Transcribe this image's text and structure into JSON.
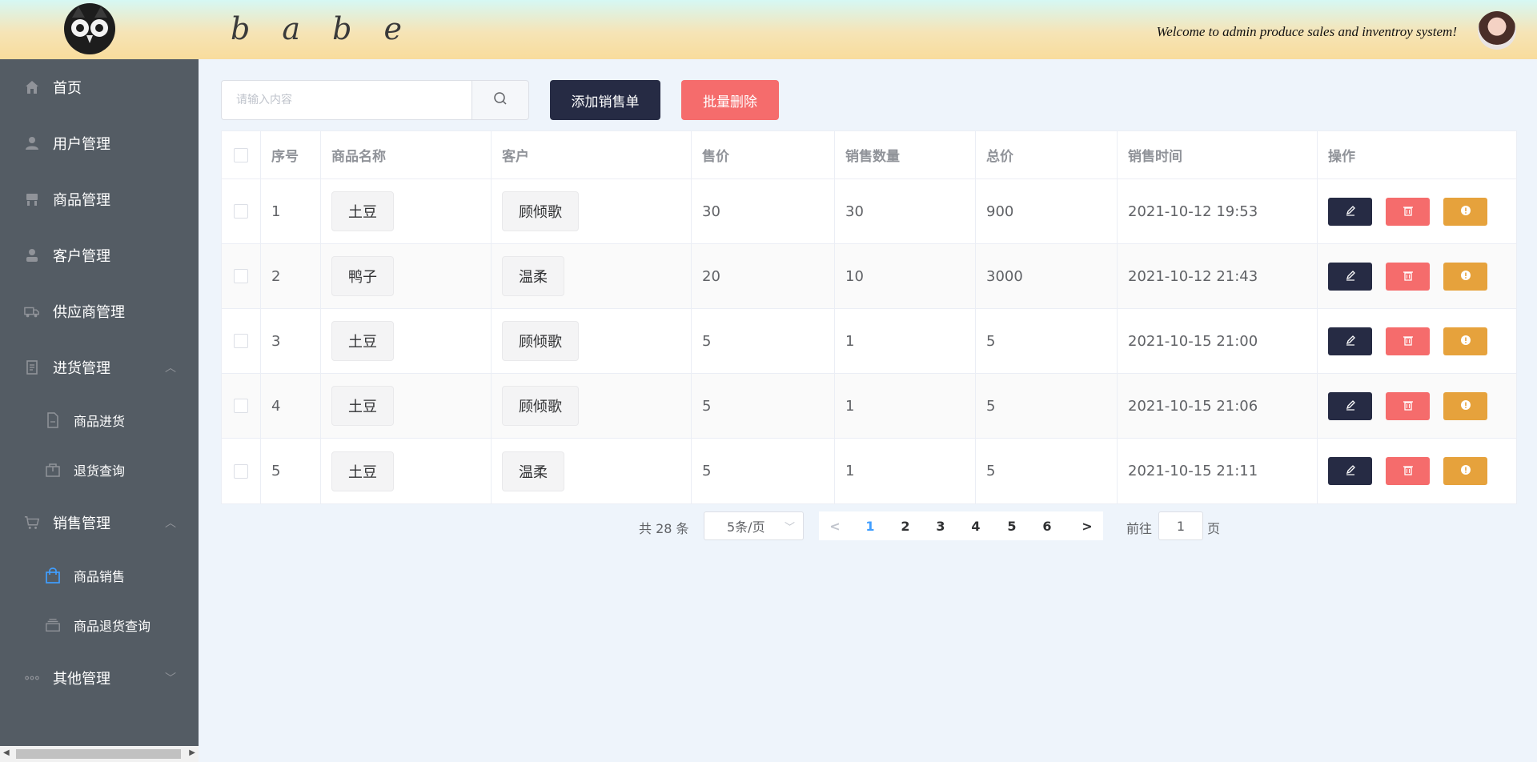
{
  "header": {
    "brand": "b a b e",
    "welcome": "Welcome to admin produce sales and inventroy system!"
  },
  "sidebar": {
    "items": [
      {
        "label": "首页",
        "icon": "home-icon"
      },
      {
        "label": "用户管理",
        "icon": "user-icon"
      },
      {
        "label": "商品管理",
        "icon": "goods-icon"
      },
      {
        "label": "客户管理",
        "icon": "customer-icon"
      },
      {
        "label": "供应商管理",
        "icon": "truck-icon"
      },
      {
        "label": "进货管理",
        "icon": "document-icon"
      },
      {
        "label": "商品进货",
        "icon": "file-icon"
      },
      {
        "label": "退货查询",
        "icon": "box-icon"
      },
      {
        "label": "销售管理",
        "icon": "cart-icon"
      },
      {
        "label": "商品销售",
        "icon": "shopping-bag-icon"
      },
      {
        "label": "商品退货查询",
        "icon": "stack-icon"
      },
      {
        "label": "其他管理",
        "icon": "more-icon"
      }
    ]
  },
  "toolbar": {
    "search_placeholder": "请输入内容",
    "add_label": "添加销售单",
    "batch_delete_label": "批量删除"
  },
  "table": {
    "columns": [
      "序号",
      "商品名称",
      "客户",
      "售价",
      "销售数量",
      "总价",
      "销售时间",
      "操作"
    ],
    "rows": [
      {
        "id": "1",
        "product": "土豆",
        "customer": "顾倾歌",
        "price": "30",
        "qty": "30",
        "total": "900",
        "time": "2021-10-12 19:53"
      },
      {
        "id": "2",
        "product": "鸭子",
        "customer": "温柔",
        "price": "20",
        "qty": "10",
        "total": "3000",
        "time": "2021-10-12 21:43"
      },
      {
        "id": "3",
        "product": "土豆",
        "customer": "顾倾歌",
        "price": "5",
        "qty": "1",
        "total": "5",
        "time": "2021-10-15 21:00"
      },
      {
        "id": "4",
        "product": "土豆",
        "customer": "顾倾歌",
        "price": "5",
        "qty": "1",
        "total": "5",
        "time": "2021-10-15 21:06"
      },
      {
        "id": "5",
        "product": "土豆",
        "customer": "温柔",
        "price": "5",
        "qty": "1",
        "total": "5",
        "time": "2021-10-15 21:11"
      }
    ]
  },
  "pagination": {
    "total_text": "共 28 条",
    "page_size": "5条/页",
    "pages": [
      "1",
      "2",
      "3",
      "4",
      "5",
      "6"
    ],
    "current_page": "1",
    "goto_label": "前往",
    "goto_value": "1",
    "goto_suffix": "页"
  },
  "colors": {
    "sidebar_bg": "#545c64",
    "primary_dark": "#262b44",
    "danger": "#f56c6c",
    "warning": "#e6a23c",
    "active_blue": "#409eff"
  }
}
